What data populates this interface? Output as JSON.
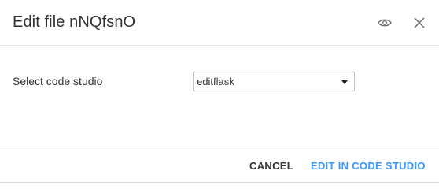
{
  "dialog": {
    "title": "Edit file nNQfsnO",
    "icons": {
      "preview": "eye-icon",
      "close": "close-icon"
    }
  },
  "form": {
    "label": "Select code studio",
    "select_value": "editflask"
  },
  "footer": {
    "cancel_label": "CANCEL",
    "edit_label": "EDIT IN CODE STUDIO"
  },
  "colors": {
    "accent": "#3b99fc",
    "text": "#333333",
    "divider": "#e3e3e3"
  }
}
